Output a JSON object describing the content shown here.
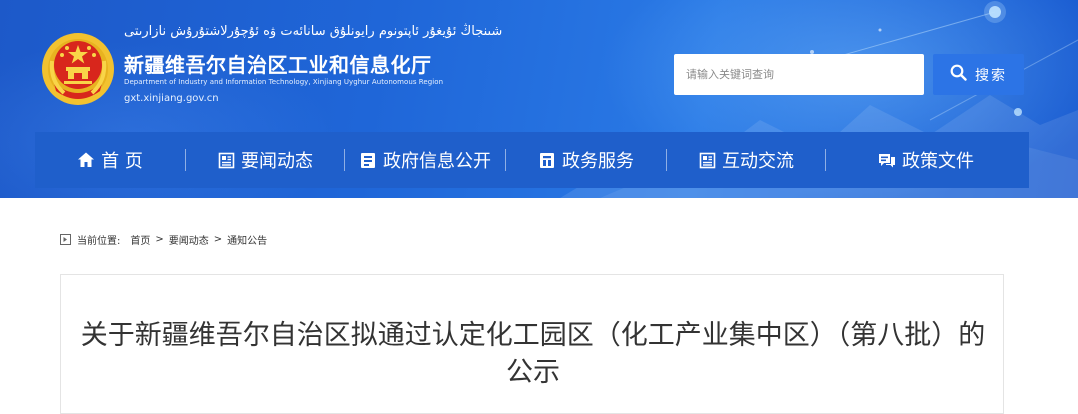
{
  "header": {
    "title_uyghur": "شىنجاڭ ئۇيغۇر ئاپتونوم رايونلۇق سانائەت ۋە ئۇچۇرلاشتۇرۇش نازارىتى",
    "title_cn": "新疆维吾尔自治区工业和信息化厅",
    "title_en": "Department of Industry and Information Technology, Xinjiang Uyghur Autonomous Region",
    "url": "gxt.xinjiang.gov.cn",
    "emblem_icon": "national-emblem-icon"
  },
  "search": {
    "placeholder": "请输入关键词查询",
    "button_label": "搜索",
    "icon": "search-icon"
  },
  "nav": {
    "items": [
      {
        "label": "首 页",
        "icon": "home-icon"
      },
      {
        "label": "要闻动态",
        "icon": "news-icon"
      },
      {
        "label": "政府信息公开",
        "icon": "document-icon"
      },
      {
        "label": "政务服务",
        "icon": "service-icon"
      },
      {
        "label": "互动交流",
        "icon": "interaction-icon"
      },
      {
        "label": "政策文件",
        "icon": "policy-icon"
      }
    ]
  },
  "breadcrumb": {
    "label": "当前位置:",
    "items": [
      "首页",
      "要闻动态",
      "通知公告"
    ],
    "separator": ">"
  },
  "article": {
    "title_line1": "关于新疆维吾尔自治区拟通过认定化工园区（化工产业集中区）（第八批）的",
    "title_line2": "公示"
  },
  "colors": {
    "banner": "#1f66d8",
    "nav": "#1f5fcb",
    "search_button": "#2c74e6"
  }
}
